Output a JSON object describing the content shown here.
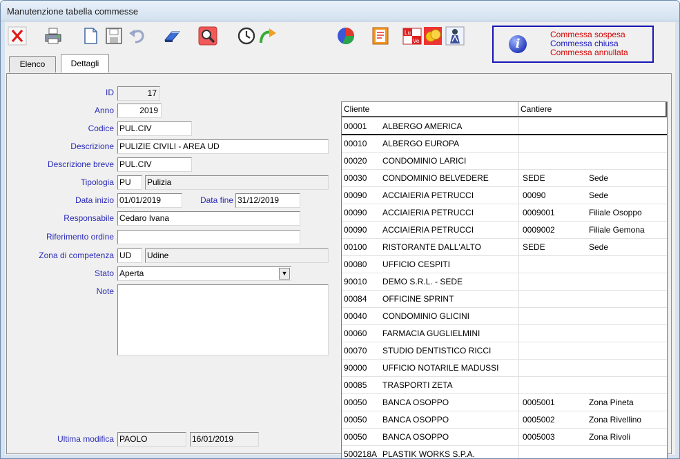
{
  "window": {
    "title": "Manutenzione tabella commesse"
  },
  "legend": {
    "icon": "info-icon",
    "items": [
      {
        "text": "Commessa sospesa",
        "color": "#d40000"
      },
      {
        "text": "Commessa chiusa",
        "color": "#1818c0"
      },
      {
        "text": "Commessa annullata",
        "color": "#d40000"
      }
    ]
  },
  "tabs": [
    {
      "label": "Elenco"
    },
    {
      "label": "Dettagli"
    }
  ],
  "form": {
    "id_label": "ID",
    "id_value": "17",
    "anno_label": "Anno",
    "anno_value": "2019",
    "codice_label": "Codice",
    "codice_value": "PUL.CIV",
    "descrizione_label": "Descrizione",
    "descrizione_value": "PULIZIE CIVILI - AREA UD",
    "descr_breve_label": "Descrizione breve",
    "descr_breve_value": "PUL.CIV",
    "tipologia_label": "Tipologia",
    "tipologia_code": "PU",
    "tipologia_desc": "Pulizia",
    "data_inizio_label": "Data inizio",
    "data_inizio_value": "01/01/2019",
    "data_fine_label": "Data fine",
    "data_fine_value": "31/12/2019",
    "responsabile_label": "Responsabile",
    "responsabile_value": "Cedaro Ivana",
    "riferimento_label": "Riferimento ordine",
    "riferimento_value": "",
    "zona_label": "Zona di competenza",
    "zona_code": "UD",
    "zona_desc": "Udine",
    "stato_label": "Stato",
    "stato_value": "Aperta",
    "note_label": "Note",
    "note_value": "",
    "ultima_label": "Ultima modifica",
    "ultima_user": "PAOLO",
    "ultima_date": "16/01/2019"
  },
  "grid": {
    "headers": [
      "Cliente",
      "Cantiere"
    ],
    "rows": [
      {
        "code": "00001",
        "name": "ALBERGO AMERICA",
        "cantiere": "",
        "desc": ""
      },
      {
        "code": "00010",
        "name": "ALBERGO EUROPA",
        "cantiere": "",
        "desc": ""
      },
      {
        "code": "00020",
        "name": "CONDOMINIO LARICI",
        "cantiere": "",
        "desc": ""
      },
      {
        "code": "00030",
        "name": "CONDOMINIO BELVEDERE",
        "cantiere": "SEDE",
        "desc": "Sede"
      },
      {
        "code": "00090",
        "name": "ACCIAIERIA PETRUCCI",
        "cantiere": "00090",
        "desc": "Sede"
      },
      {
        "code": "00090",
        "name": "ACCIAIERIA PETRUCCI",
        "cantiere": "0009001",
        "desc": "Filiale Osoppo"
      },
      {
        "code": "00090",
        "name": "ACCIAIERIA PETRUCCI",
        "cantiere": "0009002",
        "desc": "Filiale Gemona"
      },
      {
        "code": "00100",
        "name": "RISTORANTE DALL'ALTO",
        "cantiere": "SEDE",
        "desc": "Sede"
      },
      {
        "code": "00080",
        "name": "UFFICIO CESPITI",
        "cantiere": "",
        "desc": ""
      },
      {
        "code": "90010",
        "name": "DEMO S.R.L. - SEDE",
        "cantiere": "",
        "desc": ""
      },
      {
        "code": "00084",
        "name": "OFFICINE SPRINT",
        "cantiere": "",
        "desc": ""
      },
      {
        "code": "00040",
        "name": "CONDOMINIO GLICINI",
        "cantiere": "",
        "desc": ""
      },
      {
        "code": "00060",
        "name": "FARMACIA GUGLIELMINI",
        "cantiere": "",
        "desc": ""
      },
      {
        "code": "00070",
        "name": "STUDIO DENTISTICO RICCI",
        "cantiere": "",
        "desc": ""
      },
      {
        "code": "90000",
        "name": "UFFICIO NOTARILE MADUSSI",
        "cantiere": "",
        "desc": ""
      },
      {
        "code": "00085",
        "name": "TRASPORTI ZETA",
        "cantiere": "",
        "desc": ""
      },
      {
        "code": "00050",
        "name": "BANCA OSOPPO",
        "cantiere": "0005001",
        "desc": "Zona Pineta"
      },
      {
        "code": "00050",
        "name": "BANCA OSOPPO",
        "cantiere": "0005002",
        "desc": "Zona Rivellino"
      },
      {
        "code": "00050",
        "name": "BANCA OSOPPO",
        "cantiere": "0005003",
        "desc": "Zona Rivoli"
      },
      {
        "code": "500218A",
        "name": "PLASTIK WORKS S.P.A.",
        "cantiere": "",
        "desc": ""
      }
    ]
  }
}
